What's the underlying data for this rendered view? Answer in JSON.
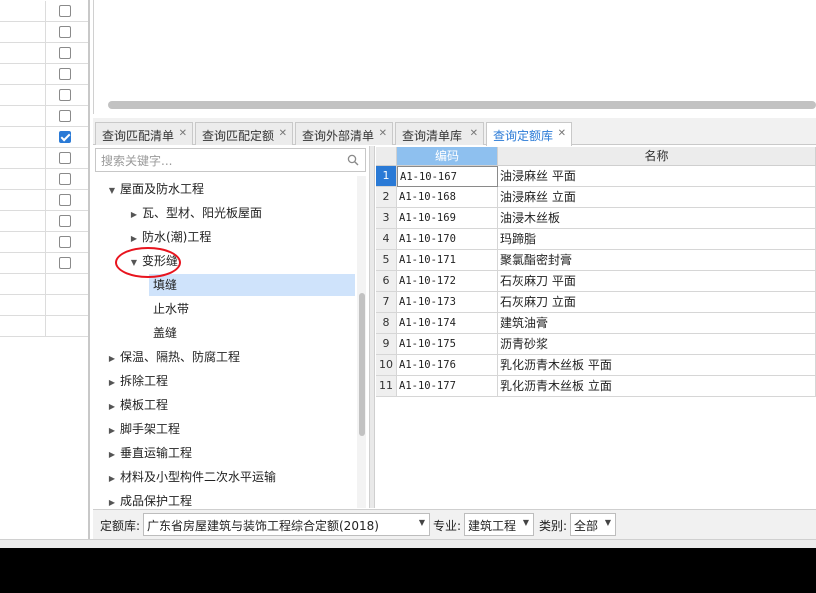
{
  "left_table": {
    "rows": [
      {
        "checked": false
      },
      {
        "checked": false
      },
      {
        "checked": false
      },
      {
        "checked": false
      },
      {
        "checked": false
      },
      {
        "checked": false
      },
      {
        "checked": true
      },
      {
        "checked": false
      },
      {
        "checked": false
      },
      {
        "checked": false
      },
      {
        "checked": false
      },
      {
        "checked": false
      },
      {
        "checked": false
      },
      {
        "checked": null
      },
      {
        "checked": null
      },
      {
        "checked": null
      }
    ]
  },
  "tabs": [
    {
      "label": "查询匹配清单",
      "active": false
    },
    {
      "label": "查询匹配定额",
      "active": false
    },
    {
      "label": "查询外部清单",
      "active": false
    },
    {
      "label": "查询清单库",
      "active": false
    },
    {
      "label": "查询定额库",
      "active": true
    }
  ],
  "search": {
    "placeholder": "搜索关键字..."
  },
  "tree": {
    "nodes": [
      {
        "label": "屋面及防水工程",
        "level": 0,
        "state": "expanded"
      },
      {
        "label": "瓦、型材、阳光板屋面",
        "level": 1,
        "state": "collapsed"
      },
      {
        "label": "防水(潮)工程",
        "level": 1,
        "state": "collapsed"
      },
      {
        "label": "变形缝",
        "level": 1,
        "state": "expanded"
      },
      {
        "label": "填缝",
        "level": 2,
        "state": "leaf",
        "selected": true
      },
      {
        "label": "止水带",
        "level": 2,
        "state": "leaf"
      },
      {
        "label": "盖缝",
        "level": 2,
        "state": "leaf"
      },
      {
        "label": "保温、隔热、防腐工程",
        "level": 0,
        "state": "collapsed"
      },
      {
        "label": "拆除工程",
        "level": 0,
        "state": "collapsed"
      },
      {
        "label": "模板工程",
        "level": 0,
        "state": "collapsed"
      },
      {
        "label": "脚手架工程",
        "level": 0,
        "state": "collapsed"
      },
      {
        "label": "垂直运输工程",
        "level": 0,
        "state": "collapsed"
      },
      {
        "label": "材料及小型构件二次水平运输",
        "level": 0,
        "state": "collapsed"
      },
      {
        "label": "成品保护工程",
        "level": 0,
        "state": "collapsed"
      }
    ]
  },
  "grid": {
    "columns": {
      "code": "编码",
      "name": "名称"
    },
    "rows": [
      {
        "index": "1",
        "code": "A1-10-167",
        "name": "油浸麻丝 平面"
      },
      {
        "index": "2",
        "code": "A1-10-168",
        "name": "油浸麻丝 立面"
      },
      {
        "index": "3",
        "code": "A1-10-169",
        "name": "油浸木丝板"
      },
      {
        "index": "4",
        "code": "A1-10-170",
        "name": "玛蹄脂"
      },
      {
        "index": "5",
        "code": "A1-10-171",
        "name": "聚氯酯密封膏"
      },
      {
        "index": "6",
        "code": "A1-10-172",
        "name": "石灰麻刀 平面"
      },
      {
        "index": "7",
        "code": "A1-10-173",
        "name": "石灰麻刀 立面"
      },
      {
        "index": "8",
        "code": "A1-10-174",
        "name": "建筑油膏"
      },
      {
        "index": "9",
        "code": "A1-10-175",
        "name": "沥青砂浆"
      },
      {
        "index": "10",
        "code": "A1-10-176",
        "name": "乳化沥青木丝板 平面"
      },
      {
        "index": "11",
        "code": "A1-10-177",
        "name": "乳化沥青木丝板 立面"
      }
    ],
    "current_row": 0
  },
  "filters": {
    "quota_lib_label": "定额库:",
    "quota_lib_value": "广东省房屋建筑与装饰工程综合定额(2018)",
    "major_label": "专业:",
    "major_value": "建筑工程",
    "category_label": "类别:",
    "category_value": "全部"
  },
  "colors": {
    "accent": "#2a7ad6",
    "header_code_bg": "#8ec0ef",
    "selected_node": "#cfe3fb",
    "annotation": "#e8141e"
  }
}
